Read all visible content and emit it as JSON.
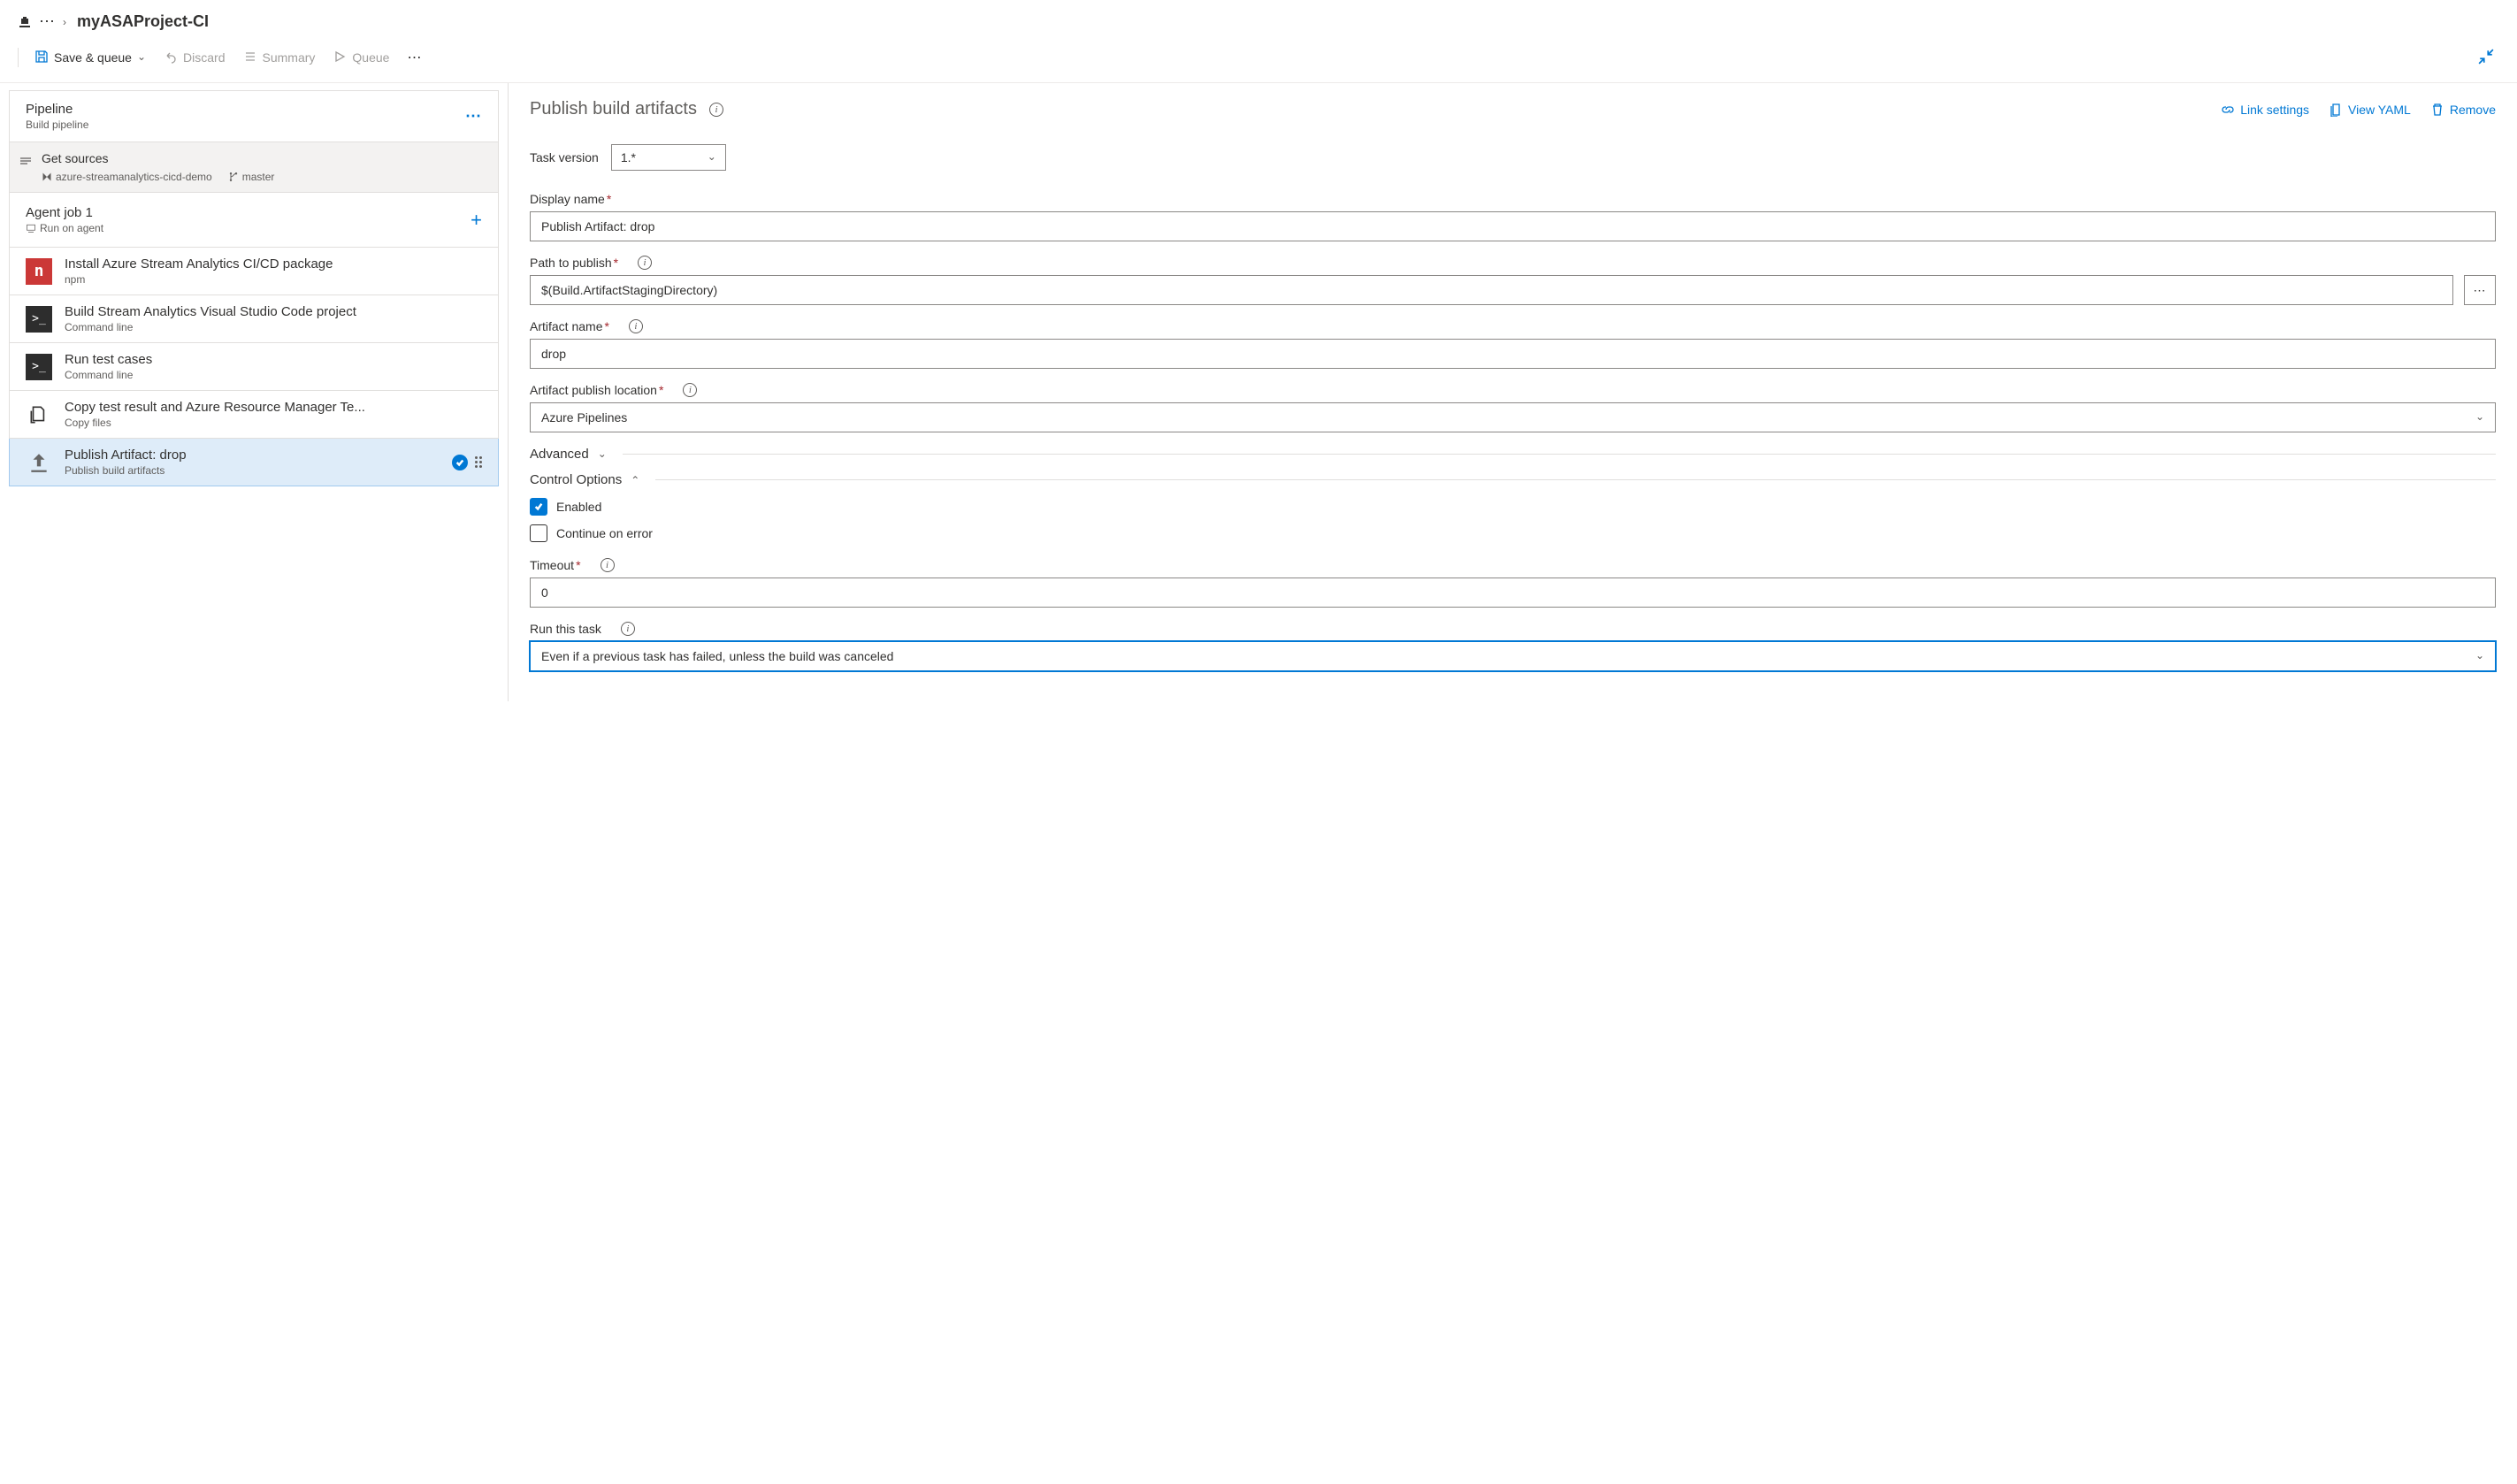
{
  "breadcrumb": {
    "title": "myASAProject-CI"
  },
  "toolbar": {
    "save_queue": "Save & queue",
    "discard": "Discard",
    "summary": "Summary",
    "queue": "Queue"
  },
  "left": {
    "pipeline": {
      "title": "Pipeline",
      "subtitle": "Build pipeline"
    },
    "sources": {
      "title": "Get sources",
      "repo": "azure-streamanalytics-cicd-demo",
      "branch": "master"
    },
    "agent": {
      "title": "Agent job 1",
      "subtitle": "Run on agent"
    },
    "tasks": [
      {
        "title": "Install Azure Stream Analytics CI/CD package",
        "sub": "npm",
        "icon": "npm"
      },
      {
        "title": "Build Stream Analytics Visual Studio Code project",
        "sub": "Command line",
        "icon": "cmd"
      },
      {
        "title": "Run test cases",
        "sub": "Command line",
        "icon": "cmd"
      },
      {
        "title": "Copy test result and Azure Resource Manager Te...",
        "sub": "Copy files",
        "icon": "copy"
      },
      {
        "title": "Publish Artifact: drop",
        "sub": "Publish build artifacts",
        "icon": "upload"
      }
    ]
  },
  "panel": {
    "title": "Publish build artifacts",
    "actions": {
      "link": "Link settings",
      "yaml": "View YAML",
      "remove": "Remove"
    },
    "task_version_label": "Task version",
    "task_version": "1.*",
    "display_name_label": "Display name",
    "display_name": "Publish Artifact: drop",
    "path_label": "Path to publish",
    "path": "$(Build.ArtifactStagingDirectory)",
    "artifact_name_label": "Artifact name",
    "artifact_name": "drop",
    "publish_loc_label": "Artifact publish location",
    "publish_loc": "Azure Pipelines",
    "advanced": "Advanced",
    "control_options": "Control Options",
    "enabled_label": "Enabled",
    "continue_label": "Continue on error",
    "timeout_label": "Timeout",
    "timeout": "0",
    "run_task_label": "Run this task",
    "run_task": "Even if a previous task has failed, unless the build was canceled"
  }
}
